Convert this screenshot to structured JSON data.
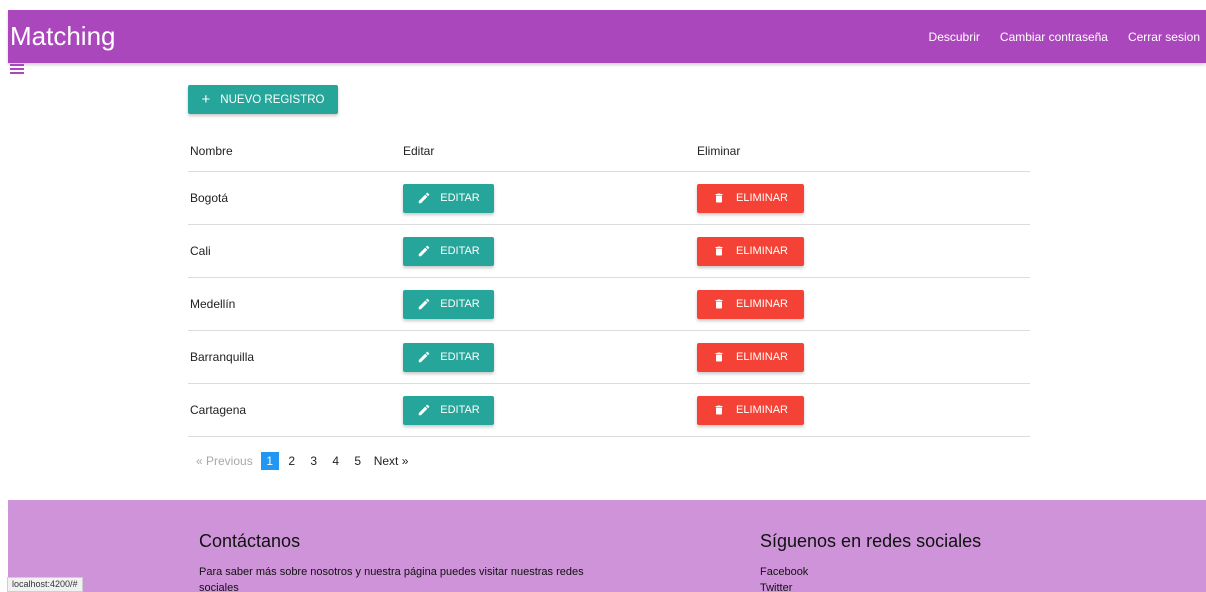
{
  "navbar": {
    "brand": "Matching",
    "links": [
      "Descubrir",
      "Cambiar contraseña",
      "Cerrar sesion"
    ]
  },
  "toolbar": {
    "new_label": "NUEVO REGISTRO"
  },
  "table": {
    "headers": [
      "Nombre",
      "Editar",
      "Eliminar"
    ],
    "rows": [
      "Bogotá",
      "Cali",
      "Medellín",
      "Barranquilla",
      "Cartagena"
    ],
    "edit_label": "EDITAR",
    "delete_label": "ELIMINAR"
  },
  "pagination": {
    "previous": "« Previous",
    "pages": [
      "1",
      "2",
      "3",
      "4",
      "5"
    ],
    "current": "1",
    "next": "Next »"
  },
  "footer": {
    "contact_title": "Contáctanos",
    "contact_text": "Para saber más sobre nosotros y nuestra página puedes visitar nuestras redes sociales",
    "social_title": "Síguenos en redes sociales",
    "social_links": [
      "Facebook",
      "Twitter"
    ]
  },
  "status_url": "localhost:4200/#",
  "colors": {
    "primary": "#ab47bc",
    "footer": "#ce93d8",
    "teal": "#26a69a",
    "red": "#f44336",
    "active_page": "#2196f3"
  },
  "icons": {
    "menu": "hamburger-icon",
    "add": "plus-icon",
    "edit": "pencil-icon",
    "delete": "trash-icon"
  }
}
